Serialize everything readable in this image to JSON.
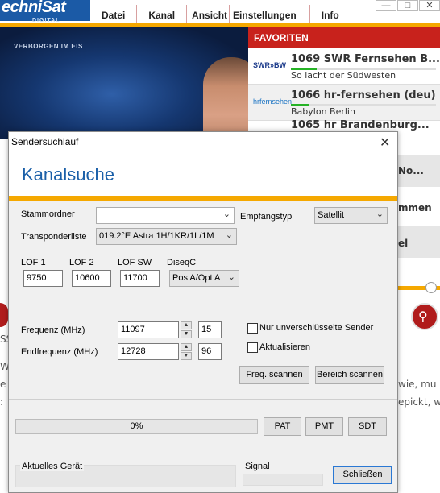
{
  "app": {
    "logo": "echniSat",
    "logo_sub": "DIGITAL",
    "menu": [
      "Datei",
      "Kanal",
      "Ansicht",
      "Einstellungen",
      "Info"
    ],
    "window_controls": [
      "—",
      "□",
      "✕"
    ],
    "video_caption": "VERBORGEN IM EIS",
    "favorites": {
      "title": "FAVORITEN",
      "items": [
        {
          "logo": "SWR»BW",
          "name": "1069 SWR Fernsehen B...",
          "program": "So lacht der Südwesten",
          "progress": 0.18
        },
        {
          "logo": "hrfernsehen",
          "name": "1066 hr-fernsehen (deu)",
          "program": "Babylon Berlin",
          "progress": 0.12
        }
      ],
      "partial": [
        "1065 hr Brandenburg...",
        "No...",
        "mmen",
        "el"
      ]
    },
    "bg_fragments": [
      "SS",
      "W",
      "e",
      ":",
      "wie, mu",
      "epickt, w"
    ]
  },
  "dialog": {
    "title": "Sendersuchlauf",
    "close": "✕",
    "heading": "Kanalsuche",
    "stammordner_label": "Stammordner",
    "stammordner_value": "",
    "empfangstyp_label": "Empfangstyp",
    "empfangstyp_value": "Satellit",
    "transponderliste_label": "Transponderliste",
    "transponderliste_value": "019.2°E Astra 1H/1KR/1L/1M",
    "lof1_label": "LOF 1",
    "lof1_value": "9750",
    "lof2_label": "LOF 2",
    "lof2_value": "10600",
    "lofsw_label": "LOF SW",
    "lofsw_value": "11700",
    "diseqc_label": "DiseqC",
    "diseqc_value": "Pos A/Opt A",
    "frequenz_label": "Frequenz (MHz)",
    "frequenz_value": "11097",
    "frequenz_extra": "15",
    "endfrequenz_label": "Endfrequenz (MHz)",
    "endfrequenz_value": "12728",
    "endfrequenz_extra": "96",
    "chk_unverschluesselt": "Nur unverschlüsselte Sender",
    "chk_aktualisieren": "Aktualisieren",
    "btn_freq_scan": "Freq. scannen",
    "btn_bereich_scan": "Bereich scannen",
    "progress_text": "0%",
    "btn_pat": "PAT",
    "btn_pmt": "PMT",
    "btn_sdt": "SDT",
    "aktuelles_geraet_label": "Aktuelles Gerät",
    "signal_label": "Signal",
    "btn_close": "Schließen"
  }
}
